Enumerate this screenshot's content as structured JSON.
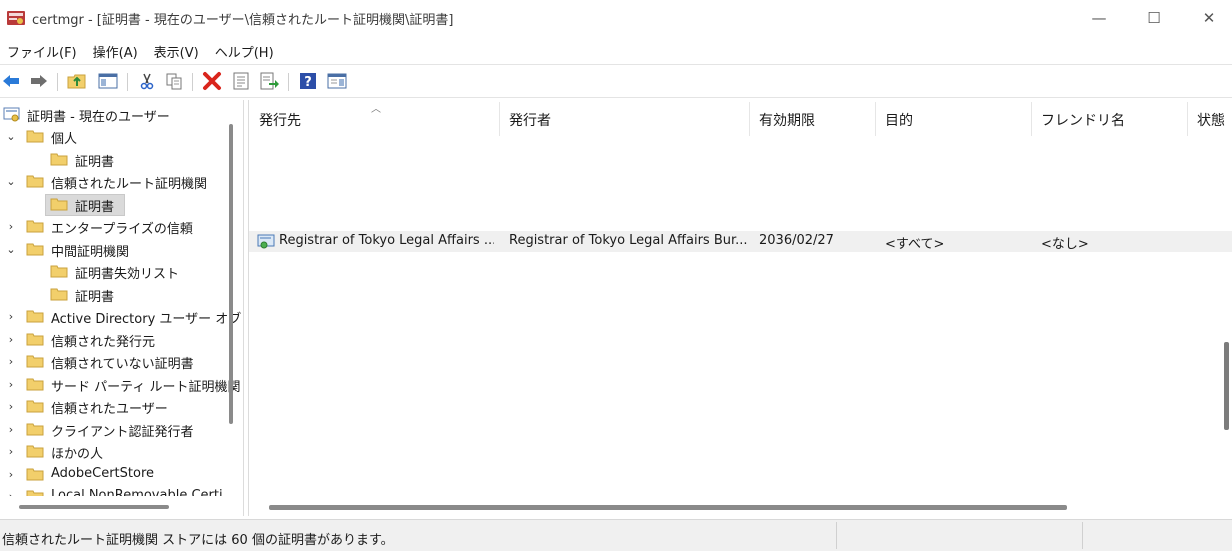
{
  "window": {
    "title": "certmgr - [証明書 - 現在のユーザー\\信頼されたルート証明機関\\証明書]",
    "minimize_glyph": "—",
    "maximize_glyph": "☐",
    "close_glyph": "✕"
  },
  "menu": [
    "ファイル(F)",
    "操作(A)",
    "表示(V)",
    "ヘルプ(H)"
  ],
  "toolbar": {
    "icons": [
      "back-icon",
      "forward-icon",
      "up-folder-icon",
      "show-hide-tree-icon",
      "cut-icon",
      "copy-icon",
      "delete-icon",
      "properties-icon",
      "export-icon",
      "help-icon",
      "action-pane-icon"
    ]
  },
  "tree": {
    "root": "証明書 - 現在のユーザー",
    "items": [
      {
        "label": "個人",
        "chev": "⌄"
      },
      {
        "label": "証明書",
        "chev": ""
      },
      {
        "label": "信頼されたルート証明機関",
        "chev": "⌄"
      },
      {
        "label": "証明書",
        "chev": ""
      },
      {
        "label": "エンタープライズの信頼",
        "chev": "›"
      },
      {
        "label": "中間証明機関",
        "chev": "⌄"
      },
      {
        "label": "証明書失効リスト",
        "chev": ""
      },
      {
        "label": "証明書",
        "chev": ""
      },
      {
        "label": "Active Directory ユーザー オブ",
        "chev": "›"
      },
      {
        "label": "信頼された発行元",
        "chev": "›"
      },
      {
        "label": "信頼されていない証明書",
        "chev": "›"
      },
      {
        "label": "サード パーティ ルート証明機関",
        "chev": "›"
      },
      {
        "label": "信頼されたユーザー",
        "chev": "›"
      },
      {
        "label": "クライアント認証発行者",
        "chev": "›"
      },
      {
        "label": "ほかの人",
        "chev": "›"
      },
      {
        "label": "AdobeCertStore",
        "chev": "›"
      },
      {
        "label": "Local NonRemovable Certi",
        "chev": "›"
      }
    ]
  },
  "list": {
    "columns": [
      "発行先",
      "発行者",
      "有効期限",
      "目的",
      "フレンドリ名",
      "状態"
    ],
    "sort_glyph": "︿",
    "selected_row": {
      "issued_to": "Registrar of Tokyo Legal Affairs ...",
      "issued_by": "Registrar of Tokyo Legal Affairs Bur...",
      "expiration": "2036/02/27",
      "purposes": "<すべて>",
      "friendly_name": "<なし>"
    }
  },
  "status": {
    "text": "信頼されたルート証明機関 ストアには 60 個の証明書があります。"
  },
  "colors": {
    "folder": "#f2cf6b",
    "delete": "#d9251c",
    "back_arrow": "#2a7ad8",
    "help": "#2c4ea8"
  }
}
